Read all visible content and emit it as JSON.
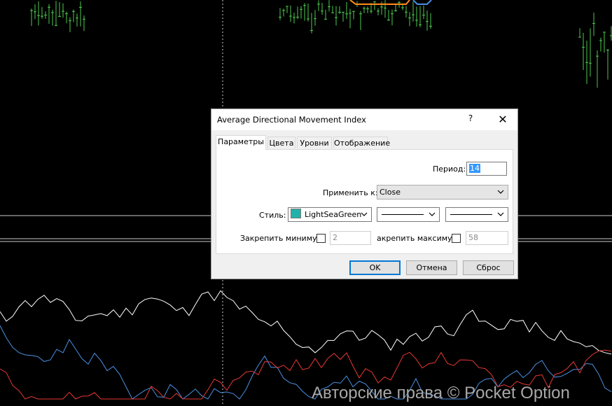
{
  "dialog": {
    "title": "Average Directional Movement Index",
    "help": "?",
    "close": "✕",
    "tabs": [
      {
        "label": "Параметры",
        "active": true
      },
      {
        "label": "Цвета",
        "active": false
      },
      {
        "label": "Уровни",
        "active": false
      },
      {
        "label": "Отображение",
        "active": false
      }
    ],
    "period": {
      "label": "Период:",
      "value": "14"
    },
    "apply_to": {
      "label": "Применить к:",
      "value": "Close"
    },
    "style": {
      "label": "Стиль:",
      "color_name": "LightSeaGreen",
      "color": "#20b2aa"
    },
    "fix_min": {
      "label": "Закрепить минимум",
      "checked": false,
      "value": "2"
    },
    "fix_max": {
      "label": "акрепить максимум",
      "checked": false,
      "value": "58"
    },
    "buttons": {
      "ok": "OK",
      "cancel": "Отмена",
      "reset": "Сброс"
    }
  },
  "watermark": "Авторские права © Pocket Option",
  "colors": {
    "candles": "#4ec94e",
    "adx": "#ffffff",
    "di_plus": "#4a90e2",
    "di_minus": "#e53935"
  }
}
